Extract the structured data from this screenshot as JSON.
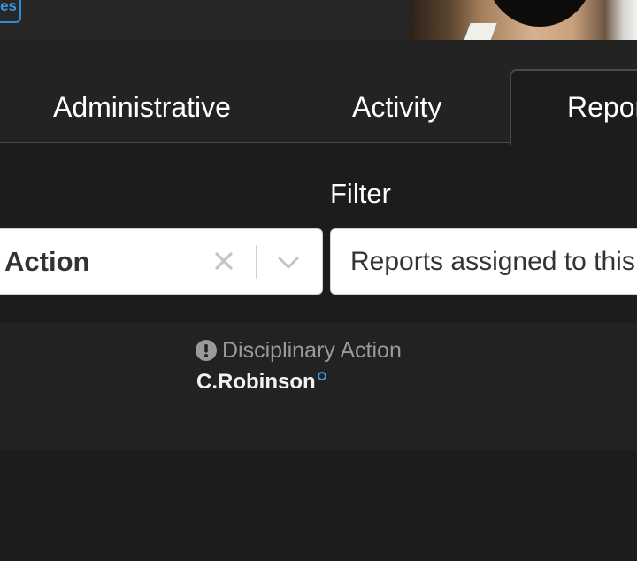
{
  "header": {
    "badge_label": "es"
  },
  "tabs": [
    {
      "label": "Administrative"
    },
    {
      "label": "Activity"
    },
    {
      "label": "Reports"
    }
  ],
  "filter": {
    "label": "Filter",
    "type_select_value": "Action",
    "search_value": "Reports assigned to this"
  },
  "results": {
    "items": [
      {
        "type": "Disciplinary Action",
        "user": "C.Robinson"
      }
    ]
  },
  "colors": {
    "accent": "#3d94e0",
    "background": "#1c1c1c"
  }
}
